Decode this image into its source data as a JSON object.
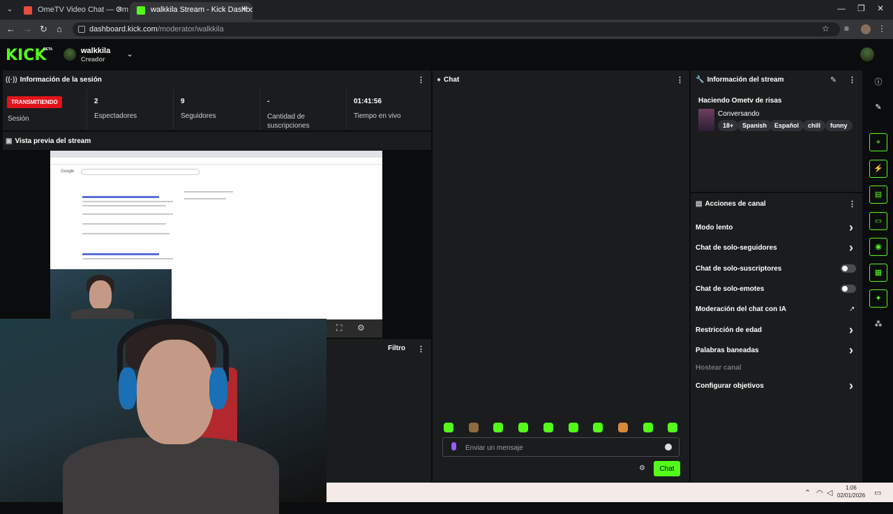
{
  "browser": {
    "tabs": [
      {
        "title": "OmeTV Video Chat — Omegle",
        "favicon_color": "#e74c3c",
        "active": false
      },
      {
        "title": "walkkila Stream - Kick Dashboa",
        "favicon_color": "#53fc18",
        "active": true
      }
    ],
    "url_host": "dashboard.kick.com",
    "url_path": "/moderator/walkkila"
  },
  "header": {
    "logo": "KICK",
    "logo_badge": "BETA",
    "username": "walkkila",
    "role": "Creador"
  },
  "session": {
    "title": "Información de la sesión",
    "badge": "TRANSMITIENDO",
    "badge_label": "Sesión",
    "stats": [
      {
        "value": "2",
        "label": "Espectadores"
      },
      {
        "value": "9",
        "label": "Seguidores"
      },
      {
        "value": "-",
        "label": "Cantidad de suscripciones"
      },
      {
        "value": "01:41:56",
        "label": "Tiempo en vivo"
      }
    ]
  },
  "preview": {
    "title": "Vista previa del stream"
  },
  "filter": {
    "label": "Filtro"
  },
  "chat": {
    "title": "Chat",
    "placeholder": "Enviar un mensaje",
    "send_label": "Chat",
    "emote_colors": [
      "#53fc18",
      "#8d6b3c",
      "#53fc18",
      "#53fc18",
      "#53fc18",
      "#53fc18",
      "#53fc18",
      "#d88a3a",
      "#53fc18",
      "#53fc18"
    ]
  },
  "stream_info": {
    "title": "Información del stream",
    "stream_title": "Haciendo Ometv de risas",
    "category": "Conversando",
    "tags": [
      "18+",
      "Spanish",
      "Español",
      "chill",
      "funny"
    ]
  },
  "channel_actions": {
    "title": "Acciones de canal",
    "items": [
      {
        "label": "Modo lento",
        "control": "chevron"
      },
      {
        "label": "Chat de solo-seguidores",
        "control": "chevron"
      },
      {
        "label": "Chat de solo-suscriptores",
        "control": "toggle"
      },
      {
        "label": "Chat de solo-emotes",
        "control": "toggle"
      },
      {
        "label": "Moderación del chat con IA",
        "control": "external"
      },
      {
        "label": "Restricción de edad",
        "control": "chevron"
      },
      {
        "label": "Palabras baneadas",
        "control": "chevron"
      },
      {
        "label": "Hostear canal",
        "control": "none"
      },
      {
        "label": "Configurar objetivos",
        "control": "chevron"
      }
    ]
  },
  "taskbar": {
    "time": "1:06",
    "date": "02/01/2026"
  }
}
